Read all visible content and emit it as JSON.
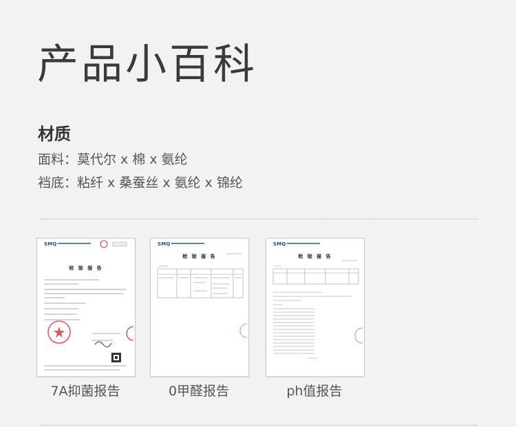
{
  "page": {
    "title": "产品小百科"
  },
  "material": {
    "heading": "材质",
    "fabric_line": "面料：莫代尔 x 棉 x 氨纶",
    "crotch_line": "裆底：粘纤 x 桑蚕丝 x 氨纶 x 锦纶"
  },
  "reports": [
    {
      "caption": "7A抑菌报告",
      "lab_logo": "SMQ",
      "doc_heading": "检 验 报 告"
    },
    {
      "caption": "0甲醛报告",
      "lab_logo": "SMQ",
      "doc_heading": "检 验 报 告"
    },
    {
      "caption": "ph值报告",
      "lab_logo": "SMQ",
      "doc_heading": "检 验 报 告"
    }
  ],
  "colors": {
    "background": "#f2f2f2",
    "logo_blue": "#1b4f9c",
    "stamp_red": "#d9363e"
  }
}
